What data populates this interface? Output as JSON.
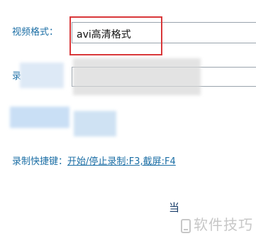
{
  "video_format": {
    "label": "视频格式：",
    "value": "avi高清格式"
  },
  "record_row": {
    "label_partial": "录"
  },
  "shortcut": {
    "label": "录制快捷键：",
    "value": "开始/停止录制:F3,截屏:F4"
  },
  "partial_text": "当",
  "watermark": {
    "text": "软件技巧"
  },
  "colors": {
    "label": "#1b6ea5",
    "highlight": "#d9383a",
    "field_border": "#9aa4ad"
  }
}
